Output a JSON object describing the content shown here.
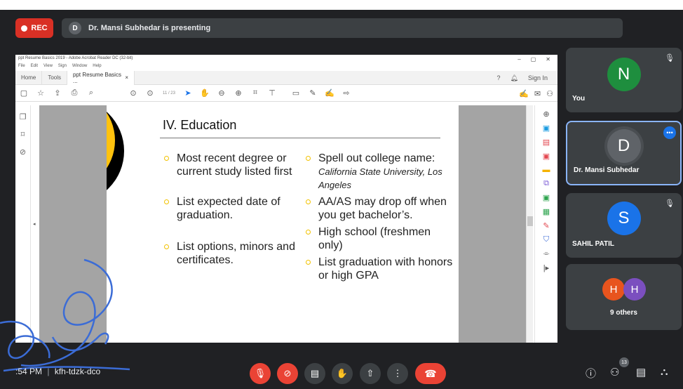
{
  "meet": {
    "rec_label": "REC",
    "presenter_initial": "D",
    "presenting_text": "Dr. Mansi Subhedar is presenting",
    "time_text": ":54 PM",
    "meeting_code": "kfh-tdzk-dco",
    "people_count": "13"
  },
  "acrobat": {
    "window_title": "ppt Resume Basics 2019 - Adobe Acrobat Reader DC (32-bit)",
    "menu": [
      "File",
      "Edit",
      "View",
      "Sign",
      "Window",
      "Help"
    ],
    "tabs": {
      "home": "Home",
      "tools": "Tools",
      "doc": "ppt Resume Basics ..."
    },
    "sign_in": "Sign In",
    "page_indicator": "11 / 23"
  },
  "slide": {
    "title": "IV. Education",
    "left_bullets": [
      "Most recent degree or current study listed first",
      "List expected date of graduation.",
      "List options, minors and certificates."
    ],
    "right_bullets": {
      "b1_main": "Spell out college name:",
      "b1_italic": "California State University, Los Angeles",
      "b2": "AA/AS may drop off when you get bachelor’s.",
      "b3": "High school (freshmen only)",
      "b4": "List graduation with honors or high GPA"
    }
  },
  "participants": [
    {
      "name": "You",
      "initial": "N",
      "color": "#1e8e3e"
    },
    {
      "name": "Dr. Mansi Subhedar",
      "initial": "D",
      "color": "#5f6368"
    },
    {
      "name": "SAHIL PATIL",
      "initial": "S",
      "color": "#1a73e8"
    },
    {
      "name": "9 others",
      "initials": [
        "H",
        "H"
      ],
      "colors": [
        "#e8541e",
        "#7b4fbf"
      ]
    }
  ]
}
